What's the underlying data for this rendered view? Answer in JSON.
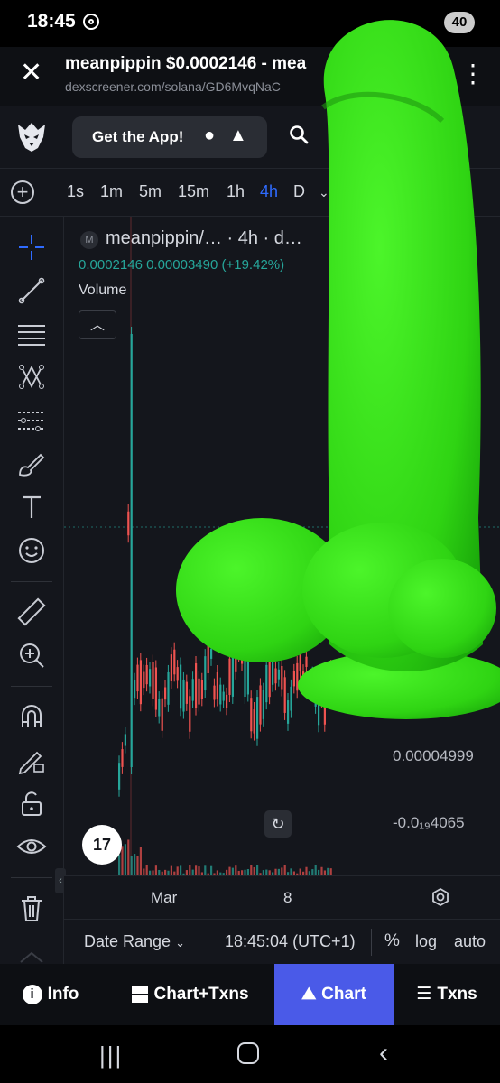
{
  "status": {
    "time": "18:45",
    "battery": "40"
  },
  "browser": {
    "title": "meanpippin $0.0002146 - mea",
    "url": "dexscreener.com/solana/GD6MvqNaC"
  },
  "header": {
    "get_app": "Get the App!"
  },
  "timeframes": [
    "1s",
    "1m",
    "5m",
    "15m",
    "1h",
    "4h",
    "D"
  ],
  "active_timeframe": "4h",
  "chart": {
    "legend_badge": "M",
    "legend_name": "meanpippin/…  · 4h · d…",
    "legend_values": "0.0002146  0.00003490 (+19.42%)",
    "volume_label": "Volume",
    "price_label_1": "0.00004999",
    "price_label_2": "-0.0₁₉4065",
    "tv_logo": "17",
    "x_labels": [
      "Mar",
      "8"
    ],
    "candle_up_color": "#26a69a",
    "candle_down_color": "#ef5350"
  },
  "range_bar": {
    "date_range": "Date Range",
    "clock": "18:45:04 (UTC+1)",
    "percent": "%",
    "log": "log",
    "auto": "auto"
  },
  "tabs": [
    {
      "label": "Info",
      "icon": "info-icon"
    },
    {
      "label": "Chart+Txns",
      "icon": "split-icon"
    },
    {
      "label": "Chart",
      "icon": "chart-icon"
    },
    {
      "label": "Txns",
      "icon": "list-icon"
    }
  ],
  "active_tab": "Chart",
  "overlay_color": "#3ee81f"
}
